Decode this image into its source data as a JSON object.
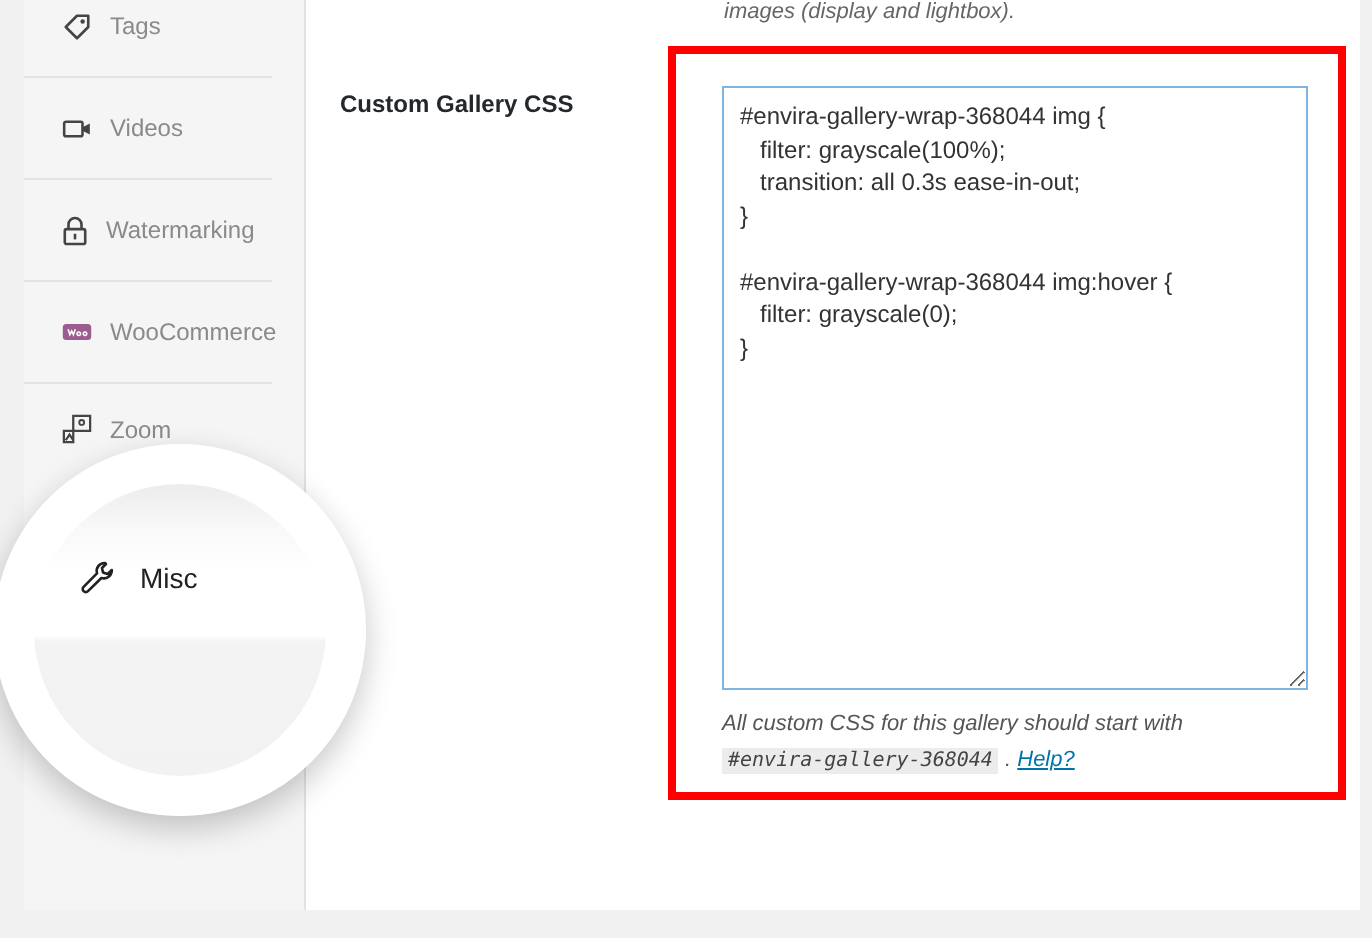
{
  "sidebar": {
    "items": [
      {
        "label": "Tags",
        "selected": false
      },
      {
        "label": "Videos",
        "selected": false
      },
      {
        "label": "Watermarking",
        "selected": false
      },
      {
        "label": "WooCommerce",
        "selected": false
      },
      {
        "label": "Zoom",
        "selected": false
      },
      {
        "label": "Misc",
        "selected": true
      }
    ]
  },
  "main": {
    "note": "images (display and lightbox).",
    "field": {
      "label": "Custom Gallery CSS",
      "value": "#envira-gallery-wrap-368044 img {\n   filter: grayscale(100%);\n   transition: all 0.3s ease-in-out;\n}\n\n#envira-gallery-wrap-368044 img:hover {\n   filter: grayscale(0);\n}",
      "description": "All custom CSS for this gallery should start with",
      "code": "#envira-gallery-368044",
      "separator": ".",
      "link": "Help?"
    }
  }
}
